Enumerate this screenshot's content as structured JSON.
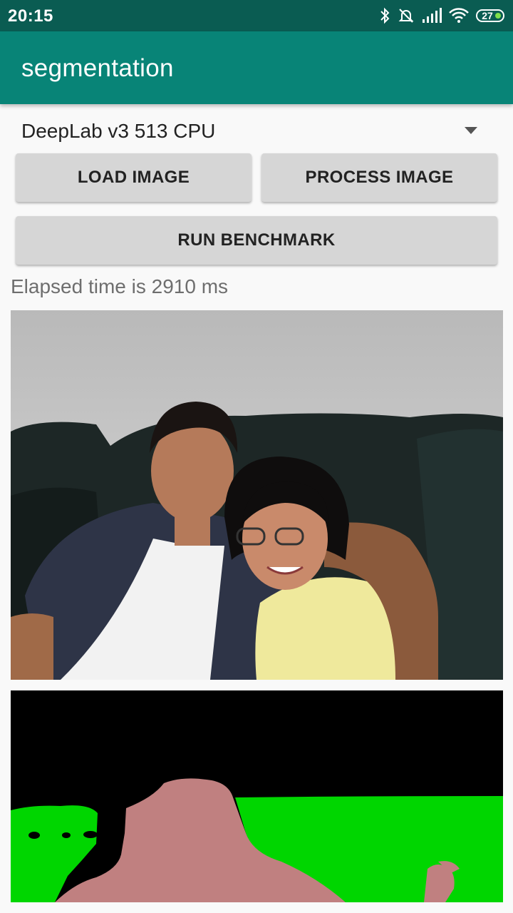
{
  "status_bar": {
    "time": "20:15",
    "battery": "27",
    "icons": [
      "bluetooth-icon",
      "mute-bell-icon",
      "signal-icon",
      "wifi-icon",
      "battery-icon"
    ]
  },
  "app_bar": {
    "title": "segmentation"
  },
  "model_selector": {
    "selected": "DeepLab v3 513 CPU"
  },
  "buttons": {
    "load": "LOAD IMAGE",
    "process": "PROCESS IMAGE",
    "benchmark": "RUN BENCHMARK"
  },
  "elapsed_text": "Elapsed time is 2910 ms",
  "colors": {
    "status_bar": "#0a5c52",
    "app_bar": "#088477",
    "button": "#d6d6d6",
    "seg_background": "#000000",
    "seg_sofa": "#00d600",
    "seg_person": "#c08080"
  }
}
